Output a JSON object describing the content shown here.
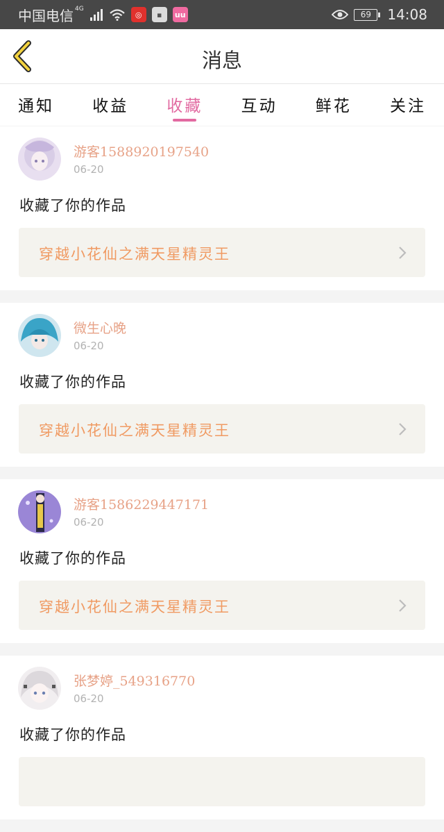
{
  "status_bar": {
    "carrier": "中国电信",
    "network": "4G",
    "battery": "69",
    "time": "14:08",
    "app_icons": [
      "netease-icon",
      "hao123-icon",
      "uu-icon"
    ]
  },
  "header": {
    "title": "消息"
  },
  "tabs": [
    {
      "label": "通知",
      "active": false
    },
    {
      "label": "收益",
      "active": false
    },
    {
      "label": "收藏",
      "active": true
    },
    {
      "label": "互动",
      "active": false
    },
    {
      "label": "鲜花",
      "active": false
    },
    {
      "label": "关注",
      "active": false
    }
  ],
  "notifications": [
    {
      "user": "游客1588920197540",
      "date": "06-20",
      "action": "收藏了你的作品",
      "work": "穿越小花仙之满天星精灵王"
    },
    {
      "user": "微生心晚",
      "date": "06-20",
      "action": "收藏了你的作品",
      "work": "穿越小花仙之满天星精灵王"
    },
    {
      "user": "游客1586229447171",
      "date": "06-20",
      "action": "收藏了你的作品",
      "work": "穿越小花仙之满天星精灵王"
    },
    {
      "user": "张梦婷_549316770",
      "date": "06-20",
      "action": "收藏了你的作品",
      "work": ""
    }
  ],
  "colors": {
    "accent": "#e26aa1",
    "username": "#e7a287",
    "work_title": "#f09a62",
    "statusbar": "#474747"
  }
}
